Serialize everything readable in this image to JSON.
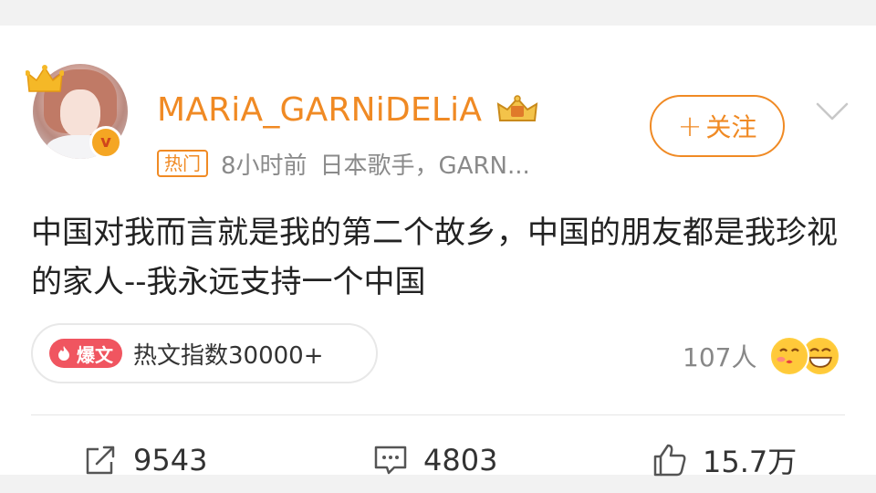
{
  "user": {
    "name": "MARiA_GARNiDELiA",
    "verified_mark": "v",
    "hot_tag": "热门",
    "time": "8小时前",
    "bio": "日本歌手，GARN..."
  },
  "follow": {
    "plus": "+",
    "label": "关注"
  },
  "post": {
    "text": "中国对我而言就是我的第二个故乡，中国的朋友都是我珍视的家人--我永远支持一个中国"
  },
  "heat": {
    "badge": "爆文",
    "text": "热文指数30000+"
  },
  "reactions": {
    "count": "107人"
  },
  "actions": {
    "repost": "9543",
    "comment": "4803",
    "like": "15.7万"
  },
  "colors": {
    "accent": "#f08a24",
    "hot_red": "#f05560",
    "text": "#222222",
    "muted": "#8a8a8a"
  }
}
